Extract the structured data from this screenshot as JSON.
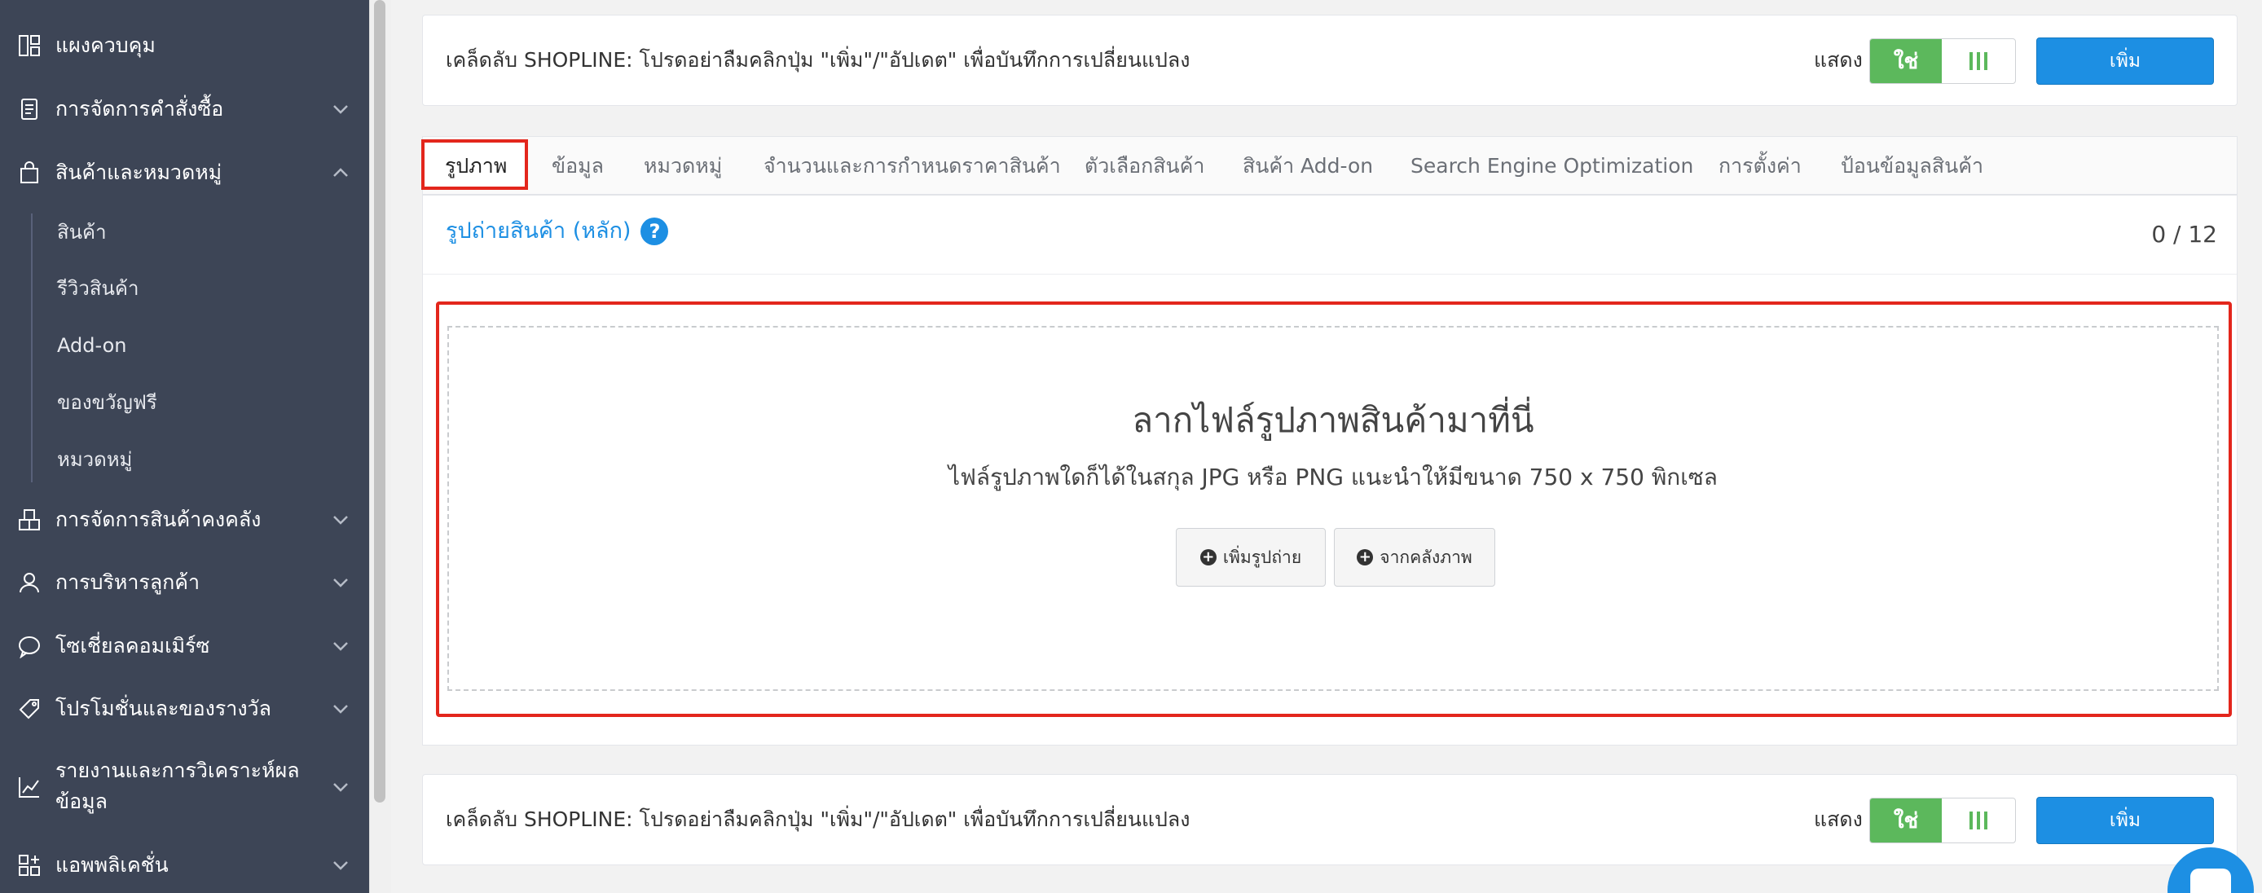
{
  "sidebar": {
    "items": [
      {
        "label": "แผงควบคุม",
        "icon": "dashboard-icon"
      },
      {
        "label": "การจัดการคำสั่งซื้อ",
        "icon": "orders-icon"
      },
      {
        "label": "สินค้าและหมวดหมู่",
        "icon": "bag-icon"
      },
      {
        "label": "การจัดการสินค้าคงคลัง",
        "icon": "warehouse-icon"
      },
      {
        "label": "การบริหารลูกค้า",
        "icon": "user-icon"
      },
      {
        "label": "โซเชี่ยลคอมเมิร์ซ",
        "icon": "chat-icon"
      },
      {
        "label": "โปรโมชั่นและของรางวัล",
        "icon": "tag-icon"
      },
      {
        "label": "รายงานและการวิเคราะห์ผล",
        "label2": "ข้อมูล",
        "icon": "chart-icon"
      },
      {
        "label": "แอพพลิเคชั่น",
        "icon": "apps-icon"
      }
    ],
    "sub_items": [
      "สินค้า",
      "รีวิวสินค้า",
      "Add-on",
      "ของขวัญฟรี",
      "หมวดหมู่"
    ]
  },
  "tip_bar": {
    "text": "เคล็ดลับ SHOPLINE: โปรดอย่าลืมคลิกปุ่ม \"เพิ่ม\"/\"อัปเดต\" เพื่อบันทึกการเปลี่ยนแปลง",
    "show_label": "แสดง",
    "toggle_yes": "ใช่",
    "add_label": "เพิ่ม"
  },
  "tabs": [
    "รูปภาพ",
    "ข้อมูล",
    "หมวดหมู่",
    "จำนวนและการกำหนดราคาสินค้า",
    "ตัวเลือกสินค้า",
    "สินค้า Add-on",
    "Search Engine Optimization",
    "การตั้งค่า",
    "ป้อนข้อมูลสินค้า"
  ],
  "active_tab": "รูปภาพ",
  "images_section": {
    "title": "รูปถ่ายสินค้า (หลัก)",
    "help": "?",
    "count": "0 / 12",
    "drop_title": "ลากไฟล์รูปภาพสินค้ามาที่นี่",
    "drop_sub": "ไฟล์รูปภาพใดก็ได้ในสกุล JPG หรือ PNG แนะนำให้มีขนาด 750 x 750 พิกเซล",
    "add_photo_label": "เพิ่มรูปถ่าย",
    "from_library_label": "จากคลังภาพ"
  },
  "colors": {
    "sidebar_bg": "#3d4556",
    "primary": "#1d8fe3",
    "toggle_green": "#5cb85c",
    "highlight_red": "#e3261c"
  }
}
